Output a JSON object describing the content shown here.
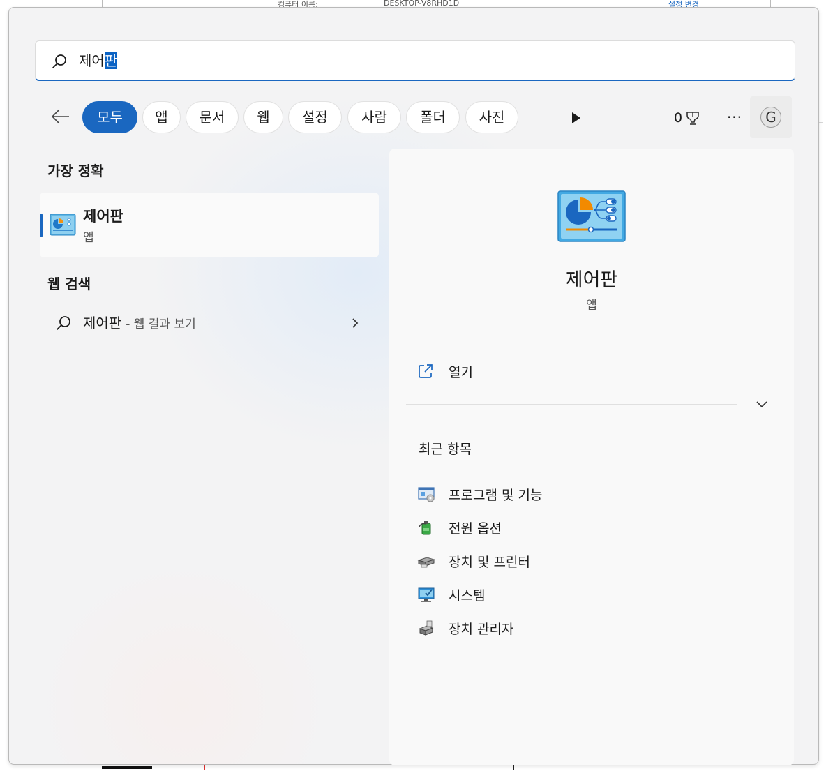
{
  "background": {
    "top_texts": [
      "컴퓨터 이름:",
      "DESKTOP-V8RHD1D",
      "설정 변경"
    ]
  },
  "search": {
    "query_prefix": "제어",
    "query_selected": "판"
  },
  "filters": {
    "tabs": [
      {
        "label": "모두",
        "active": true
      },
      {
        "label": "앱"
      },
      {
        "label": "문서"
      },
      {
        "label": "웹"
      },
      {
        "label": "설정"
      },
      {
        "label": "사람"
      },
      {
        "label": "폴더"
      },
      {
        "label": "사진"
      }
    ],
    "points": "0",
    "more": "···",
    "avatar_letter": "G"
  },
  "left": {
    "best_match_title": "가장 정확",
    "best_match": {
      "name": "제어판",
      "type": "앱"
    },
    "web_search_title": "웹 검색",
    "web_search": {
      "query": "제어판",
      "suffix": "- 웹 결과 보기"
    }
  },
  "detail": {
    "name": "제어판",
    "type": "앱",
    "open_label": "열기",
    "recent_title": "최근 항목",
    "recent_items": [
      {
        "label": "프로그램 및 기능",
        "icon": "programs-features-icon"
      },
      {
        "label": "전원 옵션",
        "icon": "power-options-icon"
      },
      {
        "label": "장치 및 프린터",
        "icon": "devices-printers-icon"
      },
      {
        "label": "시스템",
        "icon": "system-icon"
      },
      {
        "label": "장치 관리자",
        "icon": "device-manager-icon"
      }
    ]
  },
  "colors": {
    "accent": "#1a67c0",
    "panel_bg": "#f3f3f4",
    "detail_bg": "#f9f9f9"
  }
}
